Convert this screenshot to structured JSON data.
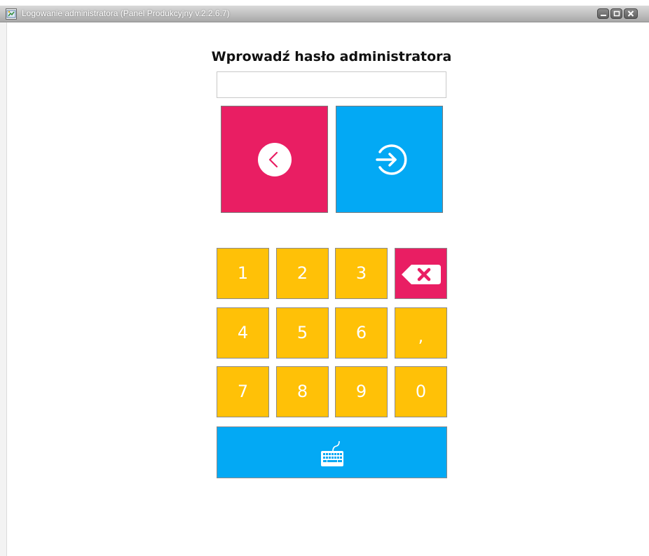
{
  "window": {
    "title": "Logowanie administratora (Panel Produkcyjny v.2.2.6.7)",
    "icon": "app-icon"
  },
  "login": {
    "heading": "Wprowadź hasło administratora",
    "password_value": "",
    "password_placeholder": ""
  },
  "actions": {
    "back_icon": "chevron-left-icon",
    "login_icon": "sign-in-arrow-icon",
    "back_color": "#e91e63",
    "login_color": "#03a9f4"
  },
  "keypad": {
    "keys": [
      "1",
      "2",
      "3",
      "backspace",
      "4",
      "5",
      "6",
      ",",
      "7",
      "8",
      "9",
      "0"
    ],
    "key_color": "#ffc107",
    "backspace_icon": "backspace-icon",
    "backspace_color": "#e91e63",
    "keyboard_icon": "keyboard-icon",
    "keyboard_color": "#03a9f4"
  }
}
